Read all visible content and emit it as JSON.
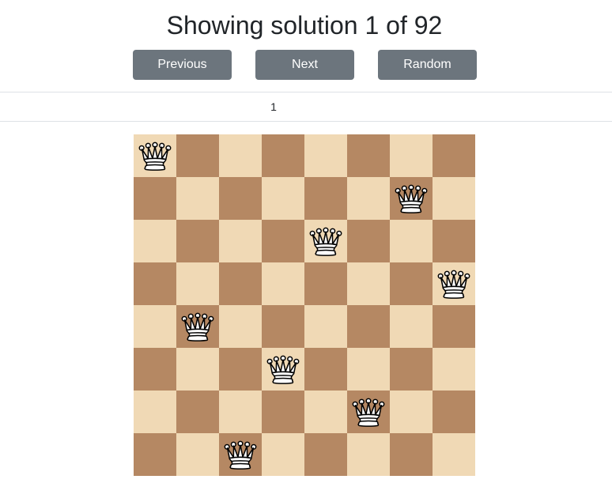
{
  "header": {
    "title": "Showing solution 1 of 92"
  },
  "controls": {
    "previous_label": "Previous",
    "next_label": "Next",
    "random_label": "Random"
  },
  "pager": {
    "current_page": "1"
  },
  "board": {
    "size": 8,
    "light_color": "#f0d9b5",
    "dark_color": "#b58863",
    "piece": "white-queen-icon",
    "queen_columns_by_row": [
      0,
      6,
      4,
      7,
      1,
      3,
      5,
      2
    ]
  }
}
